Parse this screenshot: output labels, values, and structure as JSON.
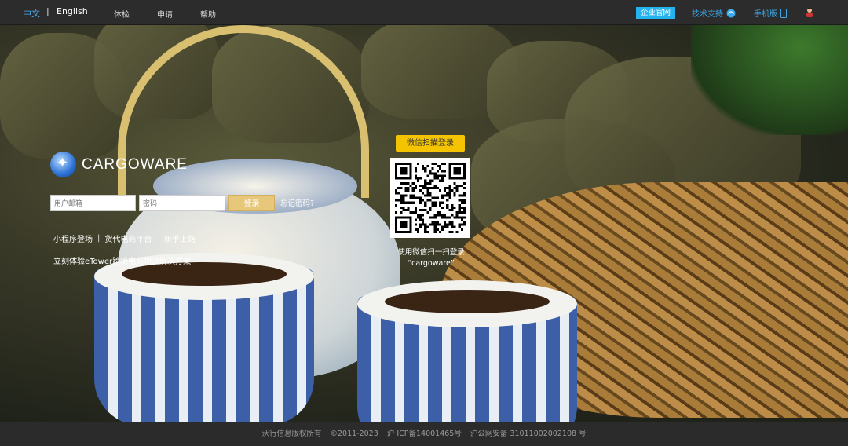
{
  "header": {
    "lang_cn": "中文",
    "lang_sep": "|",
    "lang_en": "English",
    "nav": [
      "体检",
      "申请",
      "帮助"
    ],
    "enterprise": "企业官网",
    "support": "技术支持",
    "mobile": "手机版"
  },
  "logo": {
    "text": "CARGOWARE"
  },
  "login": {
    "email_placeholder": "用户邮箱",
    "password_placeholder": "密码",
    "login_label": "登录",
    "forgot_label": "忘记密码?"
  },
  "links": {
    "items": [
      "小程序登场",
      "货代电商平台",
      "新手上路"
    ],
    "sep": "|",
    "promo": "立刻体验eTower跨境电商物流解决方案"
  },
  "qr": {
    "button_label": "微信扫描登录",
    "caption_line1": "使用微信扫一扫登录",
    "caption_line2": "“cargoware”"
  },
  "footer": {
    "company": "沃行信息版权所有",
    "copyright": "©2011-2023",
    "icp": "沪 ICP备14001465号",
    "police": "沪公网安备 31011002002108 号"
  },
  "colors": {
    "accent_blue": "#24b3ee",
    "qr_button_yellow": "#f5c400",
    "login_button_gold": "#e7c77a"
  },
  "icons": {
    "support": "headset-icon",
    "mobile": "phone-icon",
    "user": "user-avatar-icon"
  }
}
